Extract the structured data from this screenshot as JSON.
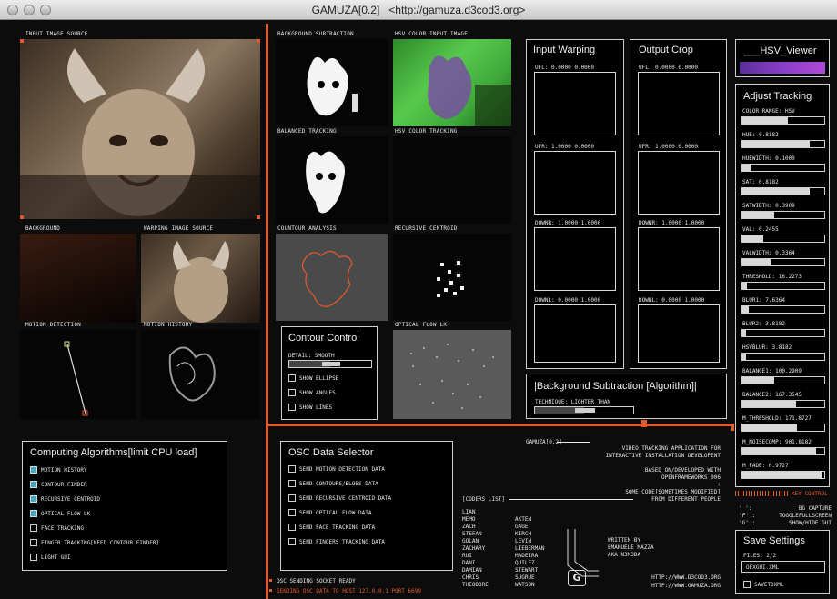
{
  "window": {
    "title": "GAMUZA[0.2]",
    "url": "<http://gamuza.d3cod3.org>"
  },
  "labels": {
    "input_image_source": "INPUT IMAGE SOURCE",
    "background": "BACKGROUND",
    "warping_image_source": "WARPING IMAGE SOURCE",
    "motion_detection": "MOTION DETECTION",
    "motion_history": "MOTION HISTORY",
    "background_subtraction": "BACKGROUND SUBTRACTION",
    "hsv_color_input_image": "HSV COLOR INPUT IMAGE",
    "balanced_tracking": "BALANCED TRACKING",
    "hsv_color_tracking": "HSV COLOR TRACKING",
    "countour_analysis": "COUNTOUR ANALYSIS",
    "recursive_centroid": "RECURSIVE CENTROID",
    "optical_flow_lk": "OPTICAL FLOW LK"
  },
  "input_warping": {
    "title": "Input Warping",
    "ufl": "UFL: 0.0000 0.0000",
    "ufr": "UFR: 1.0000 0.0000",
    "downr": "DOWNR: 1.0000 1.0000",
    "downl": "DOWNL: 0.0000 1.0000"
  },
  "output_crop": {
    "title": "Output Crop",
    "ufl": "UFL: 0.0000 0.0000",
    "ufr": "UFR: 1.0000 0.0000",
    "downr": "DOWNR: 1.0000 1.0000",
    "downl": "DOWNL: 0.0000 1.0000"
  },
  "hsv_viewer": {
    "title": "___HSV_Viewer"
  },
  "adjust_tracking": {
    "title": "Adjust Tracking",
    "items": [
      {
        "label": "COLOR RANGE: HSV",
        "value": 0.55
      },
      {
        "label": "HUE: 0.8182",
        "value": 0.82
      },
      {
        "label": "HUEWIDTH: 0.1000",
        "value": 0.1
      },
      {
        "label": "SAT: 0.8182",
        "value": 0.82
      },
      {
        "label": "SATWIDTH: 0.3909",
        "value": 0.39
      },
      {
        "label": "VAL: 0.2455",
        "value": 0.25
      },
      {
        "label": "VALWIDTH: 0.3364",
        "value": 0.34
      },
      {
        "label": "THRESHOLD: 16.2273",
        "value": 0.06
      },
      {
        "label": "BLUR1: 7.6364",
        "value": 0.08
      },
      {
        "label": "BLUR2: 3.8182",
        "value": 0.04
      },
      {
        "label": "HSVBLUR: 3.8182",
        "value": 0.04
      },
      {
        "label": "BALANCE1: 100.2909",
        "value": 0.39
      },
      {
        "label": "BALANCE2: 167.3545",
        "value": 0.66
      },
      {
        "label": "M_THRESHOLD: 171.8727",
        "value": 0.67
      },
      {
        "label": "M_NOISECOMP: 901.8182",
        "value": 0.9
      },
      {
        "label": "M_FADE: 0.9727",
        "value": 0.97
      }
    ]
  },
  "key_control": {
    "title": "KEY CONTROL",
    "rows": [
      {
        "key": "' ':",
        "action": "BG CAPTURE"
      },
      {
        "key": "'F' :",
        "action": "TOGGLEFULLSCREEN"
      },
      {
        "key": "'G' :",
        "action": "SHOW/HIDE GUI"
      }
    ]
  },
  "save_settings": {
    "title": "Save Settings",
    "files": "FILES: 2/2",
    "filename": "OFXGUI.XML",
    "savetoxml": "SAVETOXML"
  },
  "contour_control": {
    "title": "Contour Control",
    "detail": "DETAIL: SMOOTH",
    "detail_value": 0.5,
    "options": [
      {
        "label": "SHOW ELLIPSE",
        "checked": false
      },
      {
        "label": "SHOW ANGLES",
        "checked": false
      },
      {
        "label": "SHOW LINES",
        "checked": false
      }
    ]
  },
  "bg_subtraction": {
    "title": "|Background Subtraction [Algorithm]|",
    "technique": "TECHNIQUE: LIGHTER THAN",
    "technique_value": 0.5
  },
  "computing": {
    "title": "Computing Algorithms[limit CPU load]",
    "items": [
      {
        "label": "MOTION HISTORY",
        "checked": true
      },
      {
        "label": "CONTOUR FINDER",
        "checked": true
      },
      {
        "label": "RECURSIVE CENTROID",
        "checked": true
      },
      {
        "label": "OPTICAL FLOW LK",
        "checked": true
      },
      {
        "label": "FACE TRACKING",
        "checked": false
      },
      {
        "label": "FINGER TRACKING[NEED CONTOUR FINDER]",
        "checked": false
      },
      {
        "label": "LIGHT GUI",
        "checked": false
      }
    ]
  },
  "osc": {
    "title": "OSC Data Selector",
    "items": [
      {
        "label": "SEND MOTION DETECTION DATA",
        "checked": false
      },
      {
        "label": "SEND CONTOURS/BLOBS DATA",
        "checked": false
      },
      {
        "label": "SEND RECURSIVE CENTROID DATA",
        "checked": false
      },
      {
        "label": "SEND OPTICAL FLOW DATA",
        "checked": false
      },
      {
        "label": "SEND FACE TRACKING DATA",
        "checked": false
      },
      {
        "label": "SEND FINGERS TRACKING DATA",
        "checked": false
      }
    ],
    "status1": "OSC SENDING SOCKET READY",
    "status2": "SENDING OSC DATA TO HOST 127.0.0.1 PORT 6699"
  },
  "about": {
    "version": "GAMUZA[0.2]",
    "desc1": "VIDEO TRACKING APPLICATION FOR",
    "desc2": "INTERACTIVE INSTALLATION DEVELOPENT",
    "based1": "BASED ON/DEVELOPED WITH",
    "based2": "OPENFRAMEWORKS 006",
    "plus": "+",
    "some1": "SOME CODE[SOMETIMES MODIFIED]",
    "some2": "FROM DIFFERENT PEOPLE",
    "coders_title": "[CODERS LIST]",
    "coders_col1": [
      "LIAN",
      "MEMO",
      "ZACH",
      "STEFAN",
      "GOLAN",
      "ZACHARY",
      "RUI",
      "DANI",
      "DAMIAN",
      "CHRIS",
      "THEODORE"
    ],
    "coders_col2": [
      "",
      "AKTEN",
      "GAGE",
      "KIRCH",
      "LEVIN",
      "LIEBERMAN",
      "MADEIRA",
      "QUILEZ",
      "STEWART",
      "SUGRUE",
      "WATSON"
    ],
    "written1": "WRITTEN BY",
    "written2": "EMANUELE MAZZA",
    "written3": "AKA N3M3DA",
    "url1": "HTTP://WWW.D3COD3.ORG",
    "url2": "HTTP://WWW.GAMUZA.ORG",
    "logo_letter": "G"
  }
}
